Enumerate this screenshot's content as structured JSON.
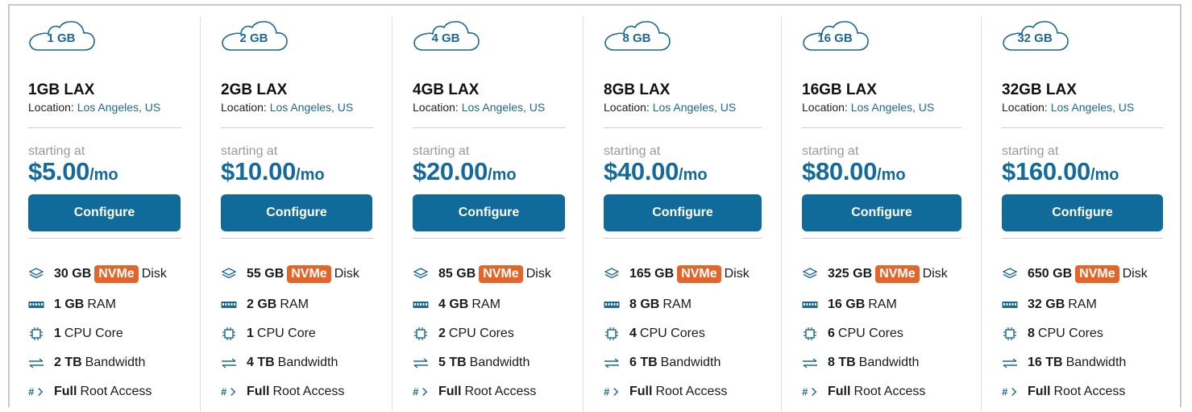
{
  "plans": [
    {
      "tag": "1 GB",
      "name": "1GB LAX",
      "location_label": "Location:",
      "location": "Los Angeles, US",
      "starting": "starting at",
      "price": "$5.00",
      "per": "/mo",
      "button": "Configure",
      "disk": "30 GB",
      "disk_badge": "NVMe",
      "disk_suffix": "Disk",
      "ram": "1 GB",
      "ram_suffix": "RAM",
      "cpu": "1",
      "cpu_suffix": "CPU Core",
      "bw": "2 TB",
      "bw_suffix": "Bandwidth",
      "root": "Full",
      "root_suffix": "Root Access"
    },
    {
      "tag": "2 GB",
      "name": "2GB LAX",
      "location_label": "Location:",
      "location": "Los Angeles, US",
      "starting": "starting at",
      "price": "$10.00",
      "per": "/mo",
      "button": "Configure",
      "disk": "55 GB",
      "disk_badge": "NVMe",
      "disk_suffix": "Disk",
      "ram": "2 GB",
      "ram_suffix": "RAM",
      "cpu": "1",
      "cpu_suffix": "CPU Core",
      "bw": "4 TB",
      "bw_suffix": "Bandwidth",
      "root": "Full",
      "root_suffix": "Root Access"
    },
    {
      "tag": "4 GB",
      "name": "4GB LAX",
      "location_label": "Location:",
      "location": "Los Angeles, US",
      "starting": "starting at",
      "price": "$20.00",
      "per": "/mo",
      "button": "Configure",
      "disk": "85 GB",
      "disk_badge": "NVMe",
      "disk_suffix": "Disk",
      "ram": "4 GB",
      "ram_suffix": "RAM",
      "cpu": "2",
      "cpu_suffix": "CPU Cores",
      "bw": "5 TB",
      "bw_suffix": "Bandwidth",
      "root": "Full",
      "root_suffix": "Root Access"
    },
    {
      "tag": "8 GB",
      "name": "8GB LAX",
      "location_label": "Location:",
      "location": "Los Angeles, US",
      "starting": "starting at",
      "price": "$40.00",
      "per": "/mo",
      "button": "Configure",
      "disk": "165 GB",
      "disk_badge": "NVMe",
      "disk_suffix": "Disk",
      "ram": "8 GB",
      "ram_suffix": "RAM",
      "cpu": "4",
      "cpu_suffix": "CPU Cores",
      "bw": "6 TB",
      "bw_suffix": "Bandwidth",
      "root": "Full",
      "root_suffix": "Root Access"
    },
    {
      "tag": "16 GB",
      "name": "16GB LAX",
      "location_label": "Location:",
      "location": "Los Angeles, US",
      "starting": "starting at",
      "price": "$80.00",
      "per": "/mo",
      "button": "Configure",
      "disk": "325 GB",
      "disk_badge": "NVMe",
      "disk_suffix": "Disk",
      "ram": "16 GB",
      "ram_suffix": "RAM",
      "cpu": "6",
      "cpu_suffix": "CPU Cores",
      "bw": "8 TB",
      "bw_suffix": "Bandwidth",
      "root": "Full",
      "root_suffix": "Root Access"
    },
    {
      "tag": "32 GB",
      "name": "32GB LAX",
      "location_label": "Location:",
      "location": "Los Angeles, US",
      "starting": "starting at",
      "price": "$160.00",
      "per": "/mo",
      "button": "Configure",
      "disk": "650 GB",
      "disk_badge": "NVMe",
      "disk_suffix": "Disk",
      "ram": "32 GB",
      "ram_suffix": "RAM",
      "cpu": "8",
      "cpu_suffix": "CPU Cores",
      "bw": "16 TB",
      "bw_suffix": "Bandwidth",
      "root": "Full",
      "root_suffix": "Root Access"
    }
  ],
  "colors": {
    "accent": "#106a9a",
    "price": "#14699d",
    "badge": "#e2662a",
    "link": "#1b6797"
  },
  "icons": {
    "disk": "layers-icon",
    "ram": "memory-icon",
    "cpu": "cpu-chip-icon",
    "bw": "transfer-arrows-icon",
    "root": "terminal-icon",
    "tag": "cloud-icon"
  }
}
